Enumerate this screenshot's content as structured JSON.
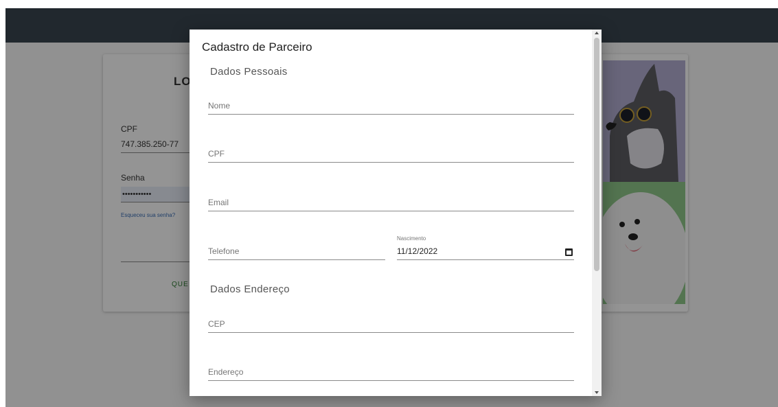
{
  "login": {
    "title": "LO",
    "cpf_label": "CPF",
    "cpf_value": "747.385.250-77",
    "password_label": "Senha",
    "password_value": "•••••••••••",
    "forgot": "Esqueceu sua senha?",
    "button": "QUE"
  },
  "modal": {
    "title": "Cadastro de Parceiro",
    "section_personal": "Dados Pessoais",
    "section_address": "Dados Endereço",
    "fields": {
      "nome": "Nome",
      "cpf": "CPF",
      "email": "Email",
      "telefone": "Telefone",
      "nascimento_label": "Nascimento",
      "nascimento_value": "11/12/2022",
      "cep": "CEP",
      "endereco": "Endereço"
    }
  },
  "colors": {
    "topbar": "#3a4650",
    "overlay": "rgba(0,0,0,0.42)",
    "accent_green": "#2e7d32",
    "link_blue": "#3b6fb6"
  },
  "icons": {
    "calendar": "calendar-icon",
    "scroll_up": "chevron-up-icon",
    "scroll_down": "chevron-down-icon"
  }
}
